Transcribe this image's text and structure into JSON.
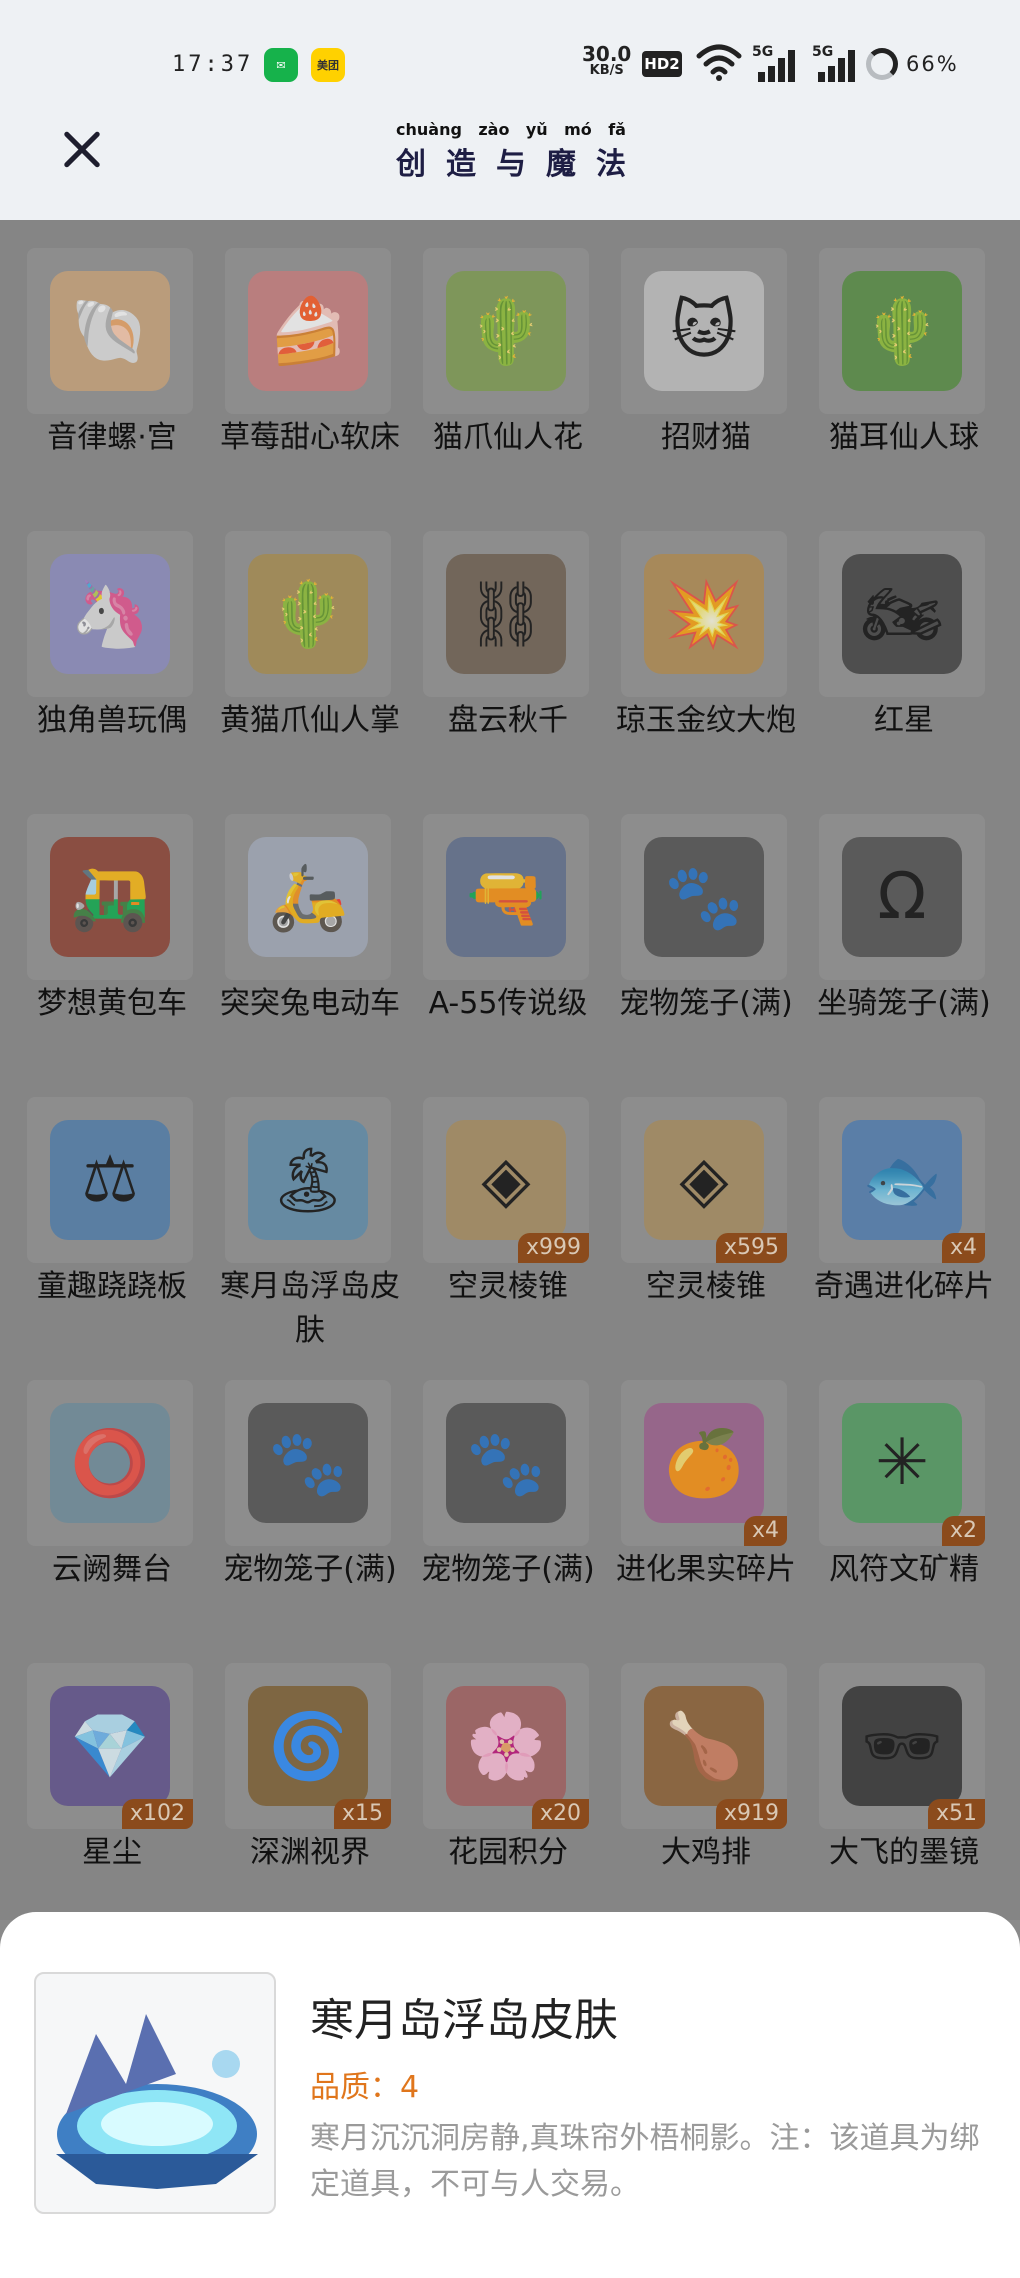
{
  "status_bar": {
    "time": "17:37",
    "app_icons": [
      "messages-icon",
      "meituan-icon"
    ],
    "meituan_label": "美团",
    "net_speed_value": "30.0",
    "net_speed_unit": "KB/S",
    "hd_label": "HD2",
    "signal_1": "5G",
    "signal_2": "5G",
    "battery": "66%"
  },
  "header": {
    "logo_pinyin": [
      "chuàng",
      "zào",
      "yǔ",
      "mó",
      "fǎ"
    ],
    "logo_chars": [
      "创",
      "造",
      "与",
      "魔",
      "法"
    ]
  },
  "items": [
    {
      "name": "音律螺·宫",
      "icon": "conch-icon",
      "color": "#c9a276",
      "glyph": "🐚"
    },
    {
      "name": "草莓甜心软床",
      "icon": "cake-bed-icon",
      "color": "#c87a7a",
      "glyph": "🍰"
    },
    {
      "name": "猫爪仙人花",
      "icon": "cat-paw-flower-icon",
      "color": "#7a9a4a",
      "glyph": "🌵"
    },
    {
      "name": "招财猫",
      "icon": "lucky-cat-icon",
      "color": "#c0c0c0",
      "glyph": "🐱"
    },
    {
      "name": "猫耳仙人球",
      "icon": "cactus-ball-icon",
      "color": "#4f8a3a",
      "glyph": "🌵"
    },
    {
      "name": "独角兽玩偶",
      "icon": "unicorn-doll-icon",
      "color": "#8a8ac0",
      "glyph": "🦄"
    },
    {
      "name": "黄猫爪仙人掌",
      "icon": "yellow-cactus-icon",
      "color": "#a58a4a",
      "glyph": "🌵"
    },
    {
      "name": "盘云秋千",
      "icon": "swing-icon",
      "color": "#6a5a4a",
      "glyph": "⛓"
    },
    {
      "name": "琼玉金纹大炮",
      "icon": "cannon-icon",
      "color": "#b0884a",
      "glyph": "💥"
    },
    {
      "name": "红星",
      "icon": "motorcycle-icon",
      "color": "#3a3a3a",
      "glyph": "🏍"
    },
    {
      "name": "梦想黄包车",
      "icon": "rickshaw-icon",
      "color": "#8a3a2a",
      "glyph": "🛺"
    },
    {
      "name": "突突兔电动车",
      "icon": "scooter-icon",
      "color": "#a0a8b8",
      "glyph": "🛵"
    },
    {
      "name": "A-55传说级",
      "icon": "rifle-icon",
      "color": "#5a6a8a",
      "glyph": "🔫"
    },
    {
      "name": "宠物笼子(满)",
      "icon": "pet-cage-icon",
      "color": "#4a4a4a",
      "glyph": "🐾"
    },
    {
      "name": "坐骑笼子(满)",
      "icon": "mount-cage-icon",
      "color": "#4a4a4a",
      "glyph": "Ω"
    },
    {
      "name": "童趣跷跷板",
      "icon": "seesaw-icon",
      "color": "#4a7aaa",
      "glyph": "⚖"
    },
    {
      "name": "寒月岛浮岛皮肤",
      "icon": "floating-island-icon",
      "color": "#5a8aaa",
      "glyph": "🏝"
    },
    {
      "name": "空灵棱锥",
      "icon": "pyramid-gem-icon",
      "color": "#a58a5a",
      "glyph": "◈",
      "count": "x999"
    },
    {
      "name": "空灵棱锥",
      "icon": "pyramid-gem-icon",
      "color": "#a58a5a",
      "glyph": "◈",
      "count": "x595"
    },
    {
      "name": "奇遇进化碎片",
      "icon": "evolution-shard-icon",
      "color": "#4a7ab0",
      "glyph": "🐟",
      "count": "x4"
    },
    {
      "name": "云阙舞台",
      "icon": "stage-icon",
      "color": "#6a8a9a",
      "glyph": "⭕"
    },
    {
      "name": "宠物笼子(满)",
      "icon": "pet-cage-icon",
      "color": "#4a4a4a",
      "glyph": "🐾"
    },
    {
      "name": "宠物笼子(满)",
      "icon": "pet-cage-icon",
      "color": "#4a4a4a",
      "glyph": "🐾"
    },
    {
      "name": "进化果实碎片",
      "icon": "fruit-shard-icon",
      "color": "#9a5a8a",
      "glyph": "🍊",
      "count": "x4"
    },
    {
      "name": "风符文矿精",
      "icon": "wind-rune-icon",
      "color": "#4a9a5a",
      "glyph": "✳",
      "count": "x2"
    },
    {
      "name": "星尘",
      "icon": "stardust-icon",
      "color": "#5a4a8a",
      "glyph": "💎",
      "count": "x102"
    },
    {
      "name": "深渊视界",
      "icon": "abyss-icon",
      "color": "#7a5a2a",
      "glyph": "🌀",
      "count": "x15"
    },
    {
      "name": "花园积分",
      "icon": "garden-points-icon",
      "color": "#a05a5a",
      "glyph": "🌸",
      "count": "x20"
    },
    {
      "name": "大鸡排",
      "icon": "chicken-cutlet-icon",
      "color": "#8a5a2a",
      "glyph": "🍗",
      "count": "x919"
    },
    {
      "name": "大飞的墨镜",
      "icon": "sunglasses-icon",
      "color": "#2a2a2a",
      "glyph": "🕶",
      "count": "x51"
    }
  ],
  "detail": {
    "title": "寒月岛浮岛皮肤",
    "quality": "品质：4",
    "description": "寒月沉沉洞房静,真珠帘外梧桐影。注：该道具为绑定道具，不可与人交易。",
    "icon": "floating-island-icon"
  }
}
